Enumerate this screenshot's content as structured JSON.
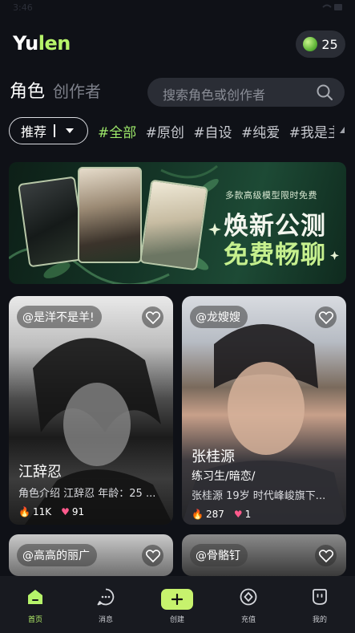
{
  "status_bar": {
    "time": "3:46",
    "system_icons": "wifi-battery"
  },
  "header": {
    "logo_prefix": "Yu",
    "logo_highlight": "len",
    "coin_count": "25",
    "accent_color": "#b6f36a"
  },
  "tabs": {
    "active": "角色",
    "inactive": "创作者"
  },
  "search": {
    "placeholder": "搜索角色或创作者"
  },
  "filter": {
    "label": "推荐"
  },
  "chips": [
    "#全部",
    "#原创",
    "#自设",
    "#纯爱",
    "#我是主"
  ],
  "banner": {
    "subtitle": "多款高级模型限时免费",
    "title_line1": "焕新公测",
    "title_line2": "免费畅聊"
  },
  "cards": [
    {
      "author": "@是洋不是羊!",
      "name": "江辞忍",
      "tags": "",
      "desc": "角色介绍 江辞忍 年龄：25 ...",
      "heat": "11K",
      "likes": "91"
    },
    {
      "author": "@龙嫂嫂",
      "name": "张桂源",
      "tags": "练习生/暗恋/",
      "desc": "张桂源 19岁 时代峰峻旗下...",
      "heat": "287",
      "likes": "1"
    },
    {
      "author": "@高高的丽广",
      "name": "",
      "tags": "",
      "desc": "",
      "heat": "",
      "likes": ""
    },
    {
      "author": "@骨骼钉",
      "name": "",
      "tags": "",
      "desc": "",
      "heat": "",
      "likes": ""
    }
  ],
  "navbar": {
    "items": [
      {
        "label": "首页",
        "icon": "home-icon",
        "active": true
      },
      {
        "label": "消息",
        "icon": "chat-icon",
        "active": false
      },
      {
        "label": "创建",
        "icon": "plus-icon",
        "active": false
      },
      {
        "label": "充值",
        "icon": "diamond-icon",
        "active": false
      },
      {
        "label": "我的",
        "icon": "profile-icon",
        "active": false
      }
    ]
  }
}
